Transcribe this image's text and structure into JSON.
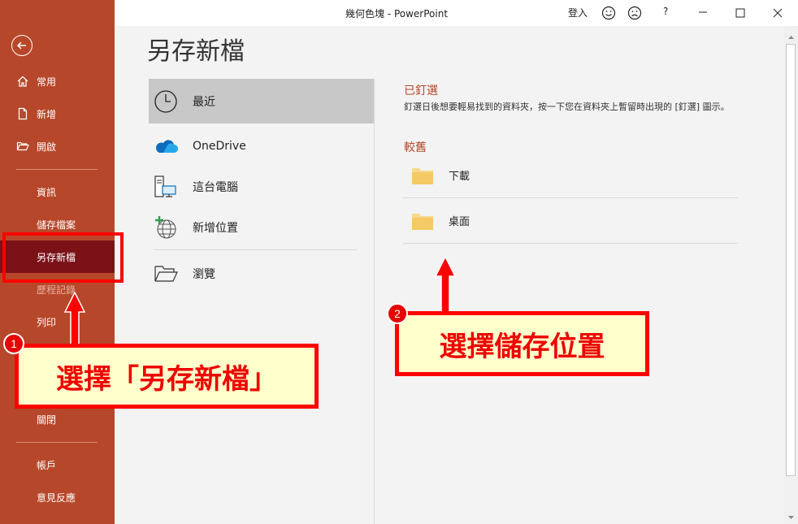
{
  "app": {
    "title": "幾何色塊 - PowerPoint",
    "signin": "登入",
    "help": "?"
  },
  "sidebar": {
    "items": [
      {
        "label": "常用",
        "icon": "home-icon"
      },
      {
        "label": "新增",
        "icon": "new-file-icon"
      },
      {
        "label": "開啟",
        "icon": "open-folder-icon"
      },
      {
        "label": "資訊"
      },
      {
        "label": "儲存檔案"
      },
      {
        "label": "另存新檔"
      },
      {
        "label": "歷程記錄"
      },
      {
        "label": "列印"
      },
      {
        "label": "關閉"
      },
      {
        "label": "帳戶"
      },
      {
        "label": "意見反應"
      }
    ]
  },
  "main": {
    "title": "另存新檔",
    "locations": [
      {
        "label": "最近",
        "icon": "clock-icon"
      },
      {
        "label": "OneDrive",
        "icon": "onedrive-cloud-icon"
      },
      {
        "label": "這台電腦",
        "icon": "pc-icon"
      },
      {
        "label": "新增位置",
        "icon": "add-location-globe-icon"
      },
      {
        "label": "瀏覽",
        "icon": "browse-folder-icon"
      }
    ],
    "pinned": {
      "title": "已釘選",
      "desc": "釘選日後想要輕易找到的資料夾，按一下您在資料夾上暫留時出現的 [釘選] 圖示。"
    },
    "older": {
      "title": "較舊",
      "folders": [
        "下載",
        "桌面"
      ]
    }
  },
  "callouts": {
    "step1": {
      "number": "1",
      "text": "選擇「另存新檔」"
    },
    "step2": {
      "number": "2",
      "text": "選擇儲存位置"
    }
  },
  "colors": {
    "accent": "#b7472a",
    "selected_nav": "#7a1218",
    "callout_red": "#ff0000",
    "callout_fill": "#ffffcc"
  }
}
